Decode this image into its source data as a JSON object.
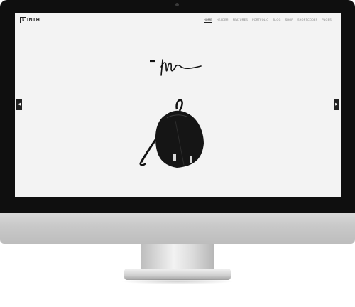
{
  "site": {
    "logo_mark": "N",
    "logo_text": "INTH"
  },
  "nav": {
    "items": [
      "HOME",
      "HEADER",
      "FEATURES",
      "PORTFOLIO",
      "BLOG",
      "SHOP",
      "SHORTCODES",
      "PAGES"
    ],
    "active_index": 0
  },
  "slider": {
    "prev_icon": "chevron-left-icon",
    "next_icon": "chevron-right-icon",
    "slide_count": 2,
    "active_slide": 1
  },
  "colors": {
    "bezel": "#0f0f0f",
    "screen_bg": "#f3f3f3",
    "text": "#222222"
  }
}
